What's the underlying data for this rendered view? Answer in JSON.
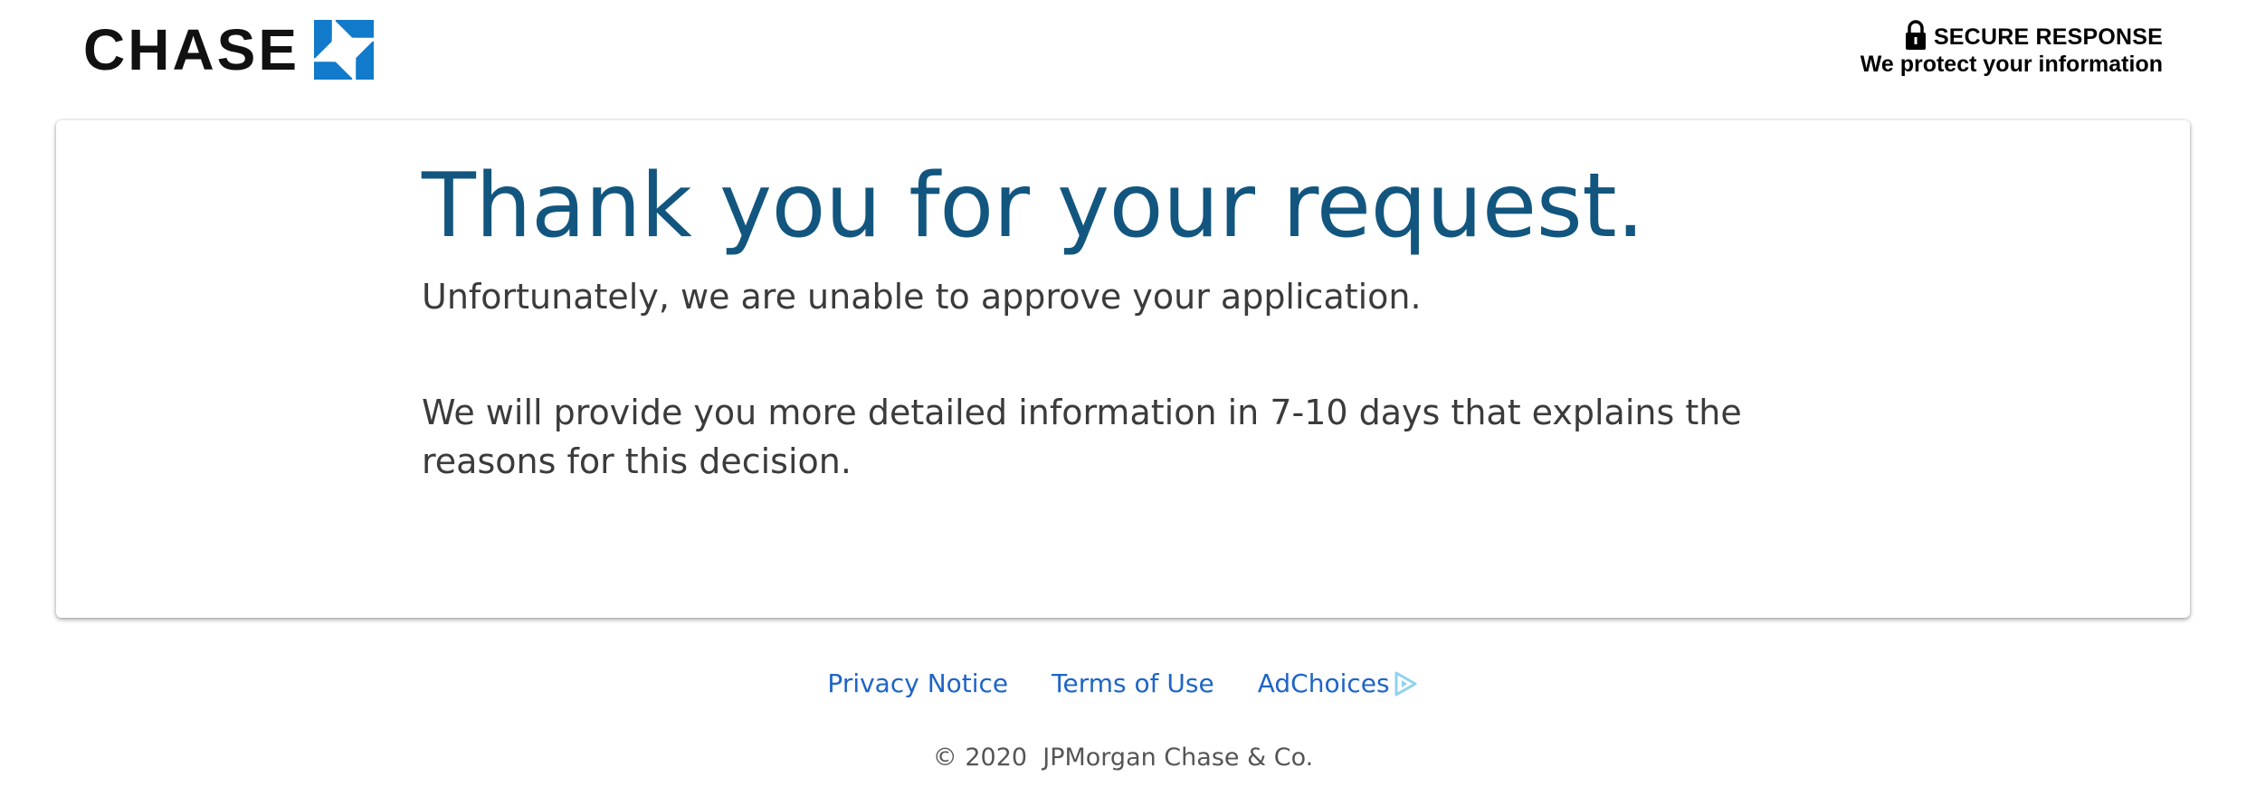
{
  "header": {
    "logo_text": "CHASE",
    "logo_icon": "chase-octagon-icon",
    "secure_title": "SECURE RESPONSE",
    "secure_subtitle": "We protect your information",
    "lock_icon": "lock-icon"
  },
  "main": {
    "headline": "Thank you for your request.",
    "message_1": "Unfortunately, we are unable to approve your application.",
    "message_2": "We will provide you more detailed information in 7-10 days that explains the reasons for this decision."
  },
  "footer": {
    "links": {
      "privacy": "Privacy Notice",
      "terms": "Terms of Use",
      "adchoices": "AdChoices"
    },
    "copyright": "© 2020  JPMorgan Chase & Co."
  },
  "colors": {
    "brand_blue": "#12567f",
    "logo_blue": "#117aca",
    "link_blue": "#1e64c8",
    "text_gray": "#3b3b3b",
    "adchoices_cyan": "#8fd3ee"
  }
}
